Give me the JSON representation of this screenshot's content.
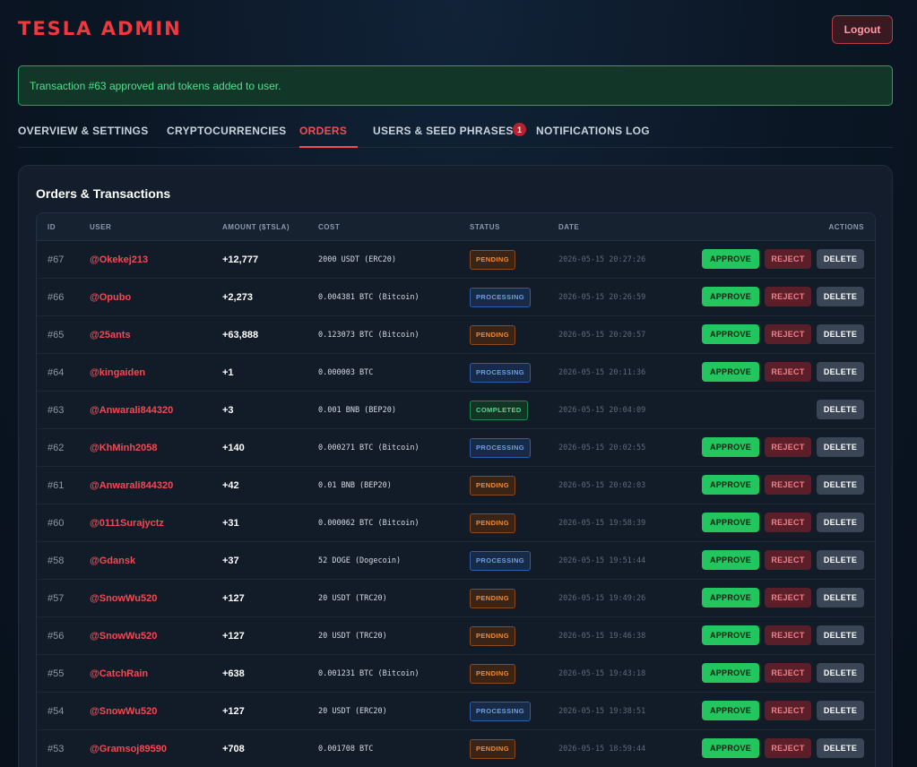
{
  "header": {
    "brand": "TESLA ADMIN",
    "logout_label": "Logout"
  },
  "alert": {
    "message": "Transaction #63 approved and tokens added to user."
  },
  "tabs": [
    {
      "label": "OVERVIEW & SETTINGS",
      "active": false
    },
    {
      "label": "CRYPTOCURRENCIES",
      "active": false
    },
    {
      "label": "ORDERS",
      "active": true
    },
    {
      "label": "USERS & SEED PHRASES",
      "active": false,
      "badge": "1"
    },
    {
      "label": "NOTIFICATIONS LOG",
      "active": false
    }
  ],
  "orders": {
    "title": "Orders & Transactions",
    "columns": [
      "ID",
      "USER",
      "AMOUNT ($TSLA)",
      "COST",
      "STATUS",
      "DATE",
      "ACTIONS"
    ],
    "action_labels": {
      "approve": "APPROVE",
      "reject": "REJECT",
      "delete": "DELETE"
    },
    "status_colors": {
      "pending": "#ee8b3a",
      "processing": "#6aa0f0",
      "completed": "#4edb8c"
    },
    "rows": [
      {
        "id": "#67",
        "user": "@Okekej213",
        "amount": "+12,777",
        "cost": "2000 USDT (ERC20)",
        "status": "PENDING",
        "date": "2026-05-15 20:27:26"
      },
      {
        "id": "#66",
        "user": "@Opubo",
        "amount": "+2,273",
        "cost": "0.004381 BTC (Bitcoin)",
        "status": "PROCESSING",
        "date": "2026-05-15 20:26:59"
      },
      {
        "id": "#65",
        "user": "@25ants",
        "amount": "+63,888",
        "cost": "0.123073 BTC (Bitcoin)",
        "status": "PENDING",
        "date": "2026-05-15 20:20:57"
      },
      {
        "id": "#64",
        "user": "@kingaiden",
        "amount": "+1",
        "cost": "0.000003 BTC",
        "status": "PROCESSING",
        "date": "2026-05-15 20:11:36"
      },
      {
        "id": "#63",
        "user": "@Anwarali844320",
        "amount": "+3",
        "cost": "0.001 BNB (BEP20)",
        "status": "COMPLETED",
        "date": "2026-05-15 20:04:09"
      },
      {
        "id": "#62",
        "user": "@KhMinh2058",
        "amount": "+140",
        "cost": "0.000271 BTC (Bitcoin)",
        "status": "PROCESSING",
        "date": "2026-05-15 20:02:55"
      },
      {
        "id": "#61",
        "user": "@Anwarali844320",
        "amount": "+42",
        "cost": "0.01 BNB (BEP20)",
        "status": "PENDING",
        "date": "2026-05-15 20:02:03"
      },
      {
        "id": "#60",
        "user": "@0111Surajyctz",
        "amount": "+31",
        "cost": "0.000062 BTC (Bitcoin)",
        "status": "PENDING",
        "date": "2026-05-15 19:58:39"
      },
      {
        "id": "#58",
        "user": "@Gdansk",
        "amount": "+37",
        "cost": "52 DOGE (Dogecoin)",
        "status": "PROCESSING",
        "date": "2026-05-15 19:51:44"
      },
      {
        "id": "#57",
        "user": "@SnowWu520",
        "amount": "+127",
        "cost": "20 USDT (TRC20)",
        "status": "PENDING",
        "date": "2026-05-15 19:49:26"
      },
      {
        "id": "#56",
        "user": "@SnowWu520",
        "amount": "+127",
        "cost": "20 USDT (TRC20)",
        "status": "PENDING",
        "date": "2026-05-15 19:46:38"
      },
      {
        "id": "#55",
        "user": "@CatchRain",
        "amount": "+638",
        "cost": "0.001231 BTC (Bitcoin)",
        "status": "PENDING",
        "date": "2026-05-15 19:43:18"
      },
      {
        "id": "#54",
        "user": "@SnowWu520",
        "amount": "+127",
        "cost": "20 USDT (ERC20)",
        "status": "PROCESSING",
        "date": "2026-05-15 19:38:51"
      },
      {
        "id": "#53",
        "user": "@Gramsoj89590",
        "amount": "+708",
        "cost": "0.001708 BTC",
        "status": "PENDING",
        "date": "2026-05-15 18:59:44"
      }
    ]
  }
}
